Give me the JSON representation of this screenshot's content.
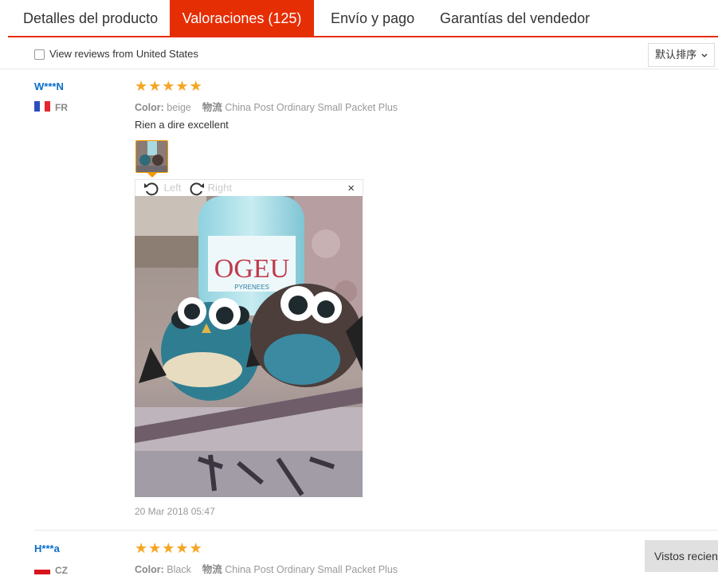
{
  "tabs": [
    {
      "label": "Detalles del producto"
    },
    {
      "label": "Valoraciones (125)"
    },
    {
      "label": "Envío y pago"
    },
    {
      "label": "Garantías del vendedor"
    }
  ],
  "filter": {
    "checkbox_label": "View reviews from United States",
    "sort_label": "默认排序"
  },
  "reviews": [
    {
      "user": "W***N",
      "country": "FR",
      "stars": 5,
      "color_label": "Color:",
      "color_value": "beige",
      "shipping_label": "物流",
      "shipping_value": "China Post Ordinary Small Packet Plus",
      "text": "Rien a dire excellent",
      "date": "20 Mar 2018 05:47"
    },
    {
      "user": "H***a",
      "country": "CZ",
      "stars": 5,
      "color_label": "Color:",
      "color_value": "Black",
      "shipping_label": "物流",
      "shipping_value": "China Post Ordinary Small Packet Plus"
    }
  ],
  "viewer": {
    "rotate_left": "Left",
    "rotate_right": "Right",
    "close": "×"
  },
  "photo_text": {
    "bottle_brand": "OGEU",
    "bottle_sub": "PYRENEES"
  },
  "recent_button": "Vistos recien",
  "icons": {
    "star": "star-icon",
    "rotate_left": "rotate-left-icon",
    "rotate_right": "rotate-right-icon",
    "close": "close-icon",
    "chevron": "chevron-down-icon"
  },
  "colors": {
    "accent": "#e62e04",
    "star": "#f5a623",
    "link": "#0a6fc9",
    "thumb_border": "#f39800"
  }
}
